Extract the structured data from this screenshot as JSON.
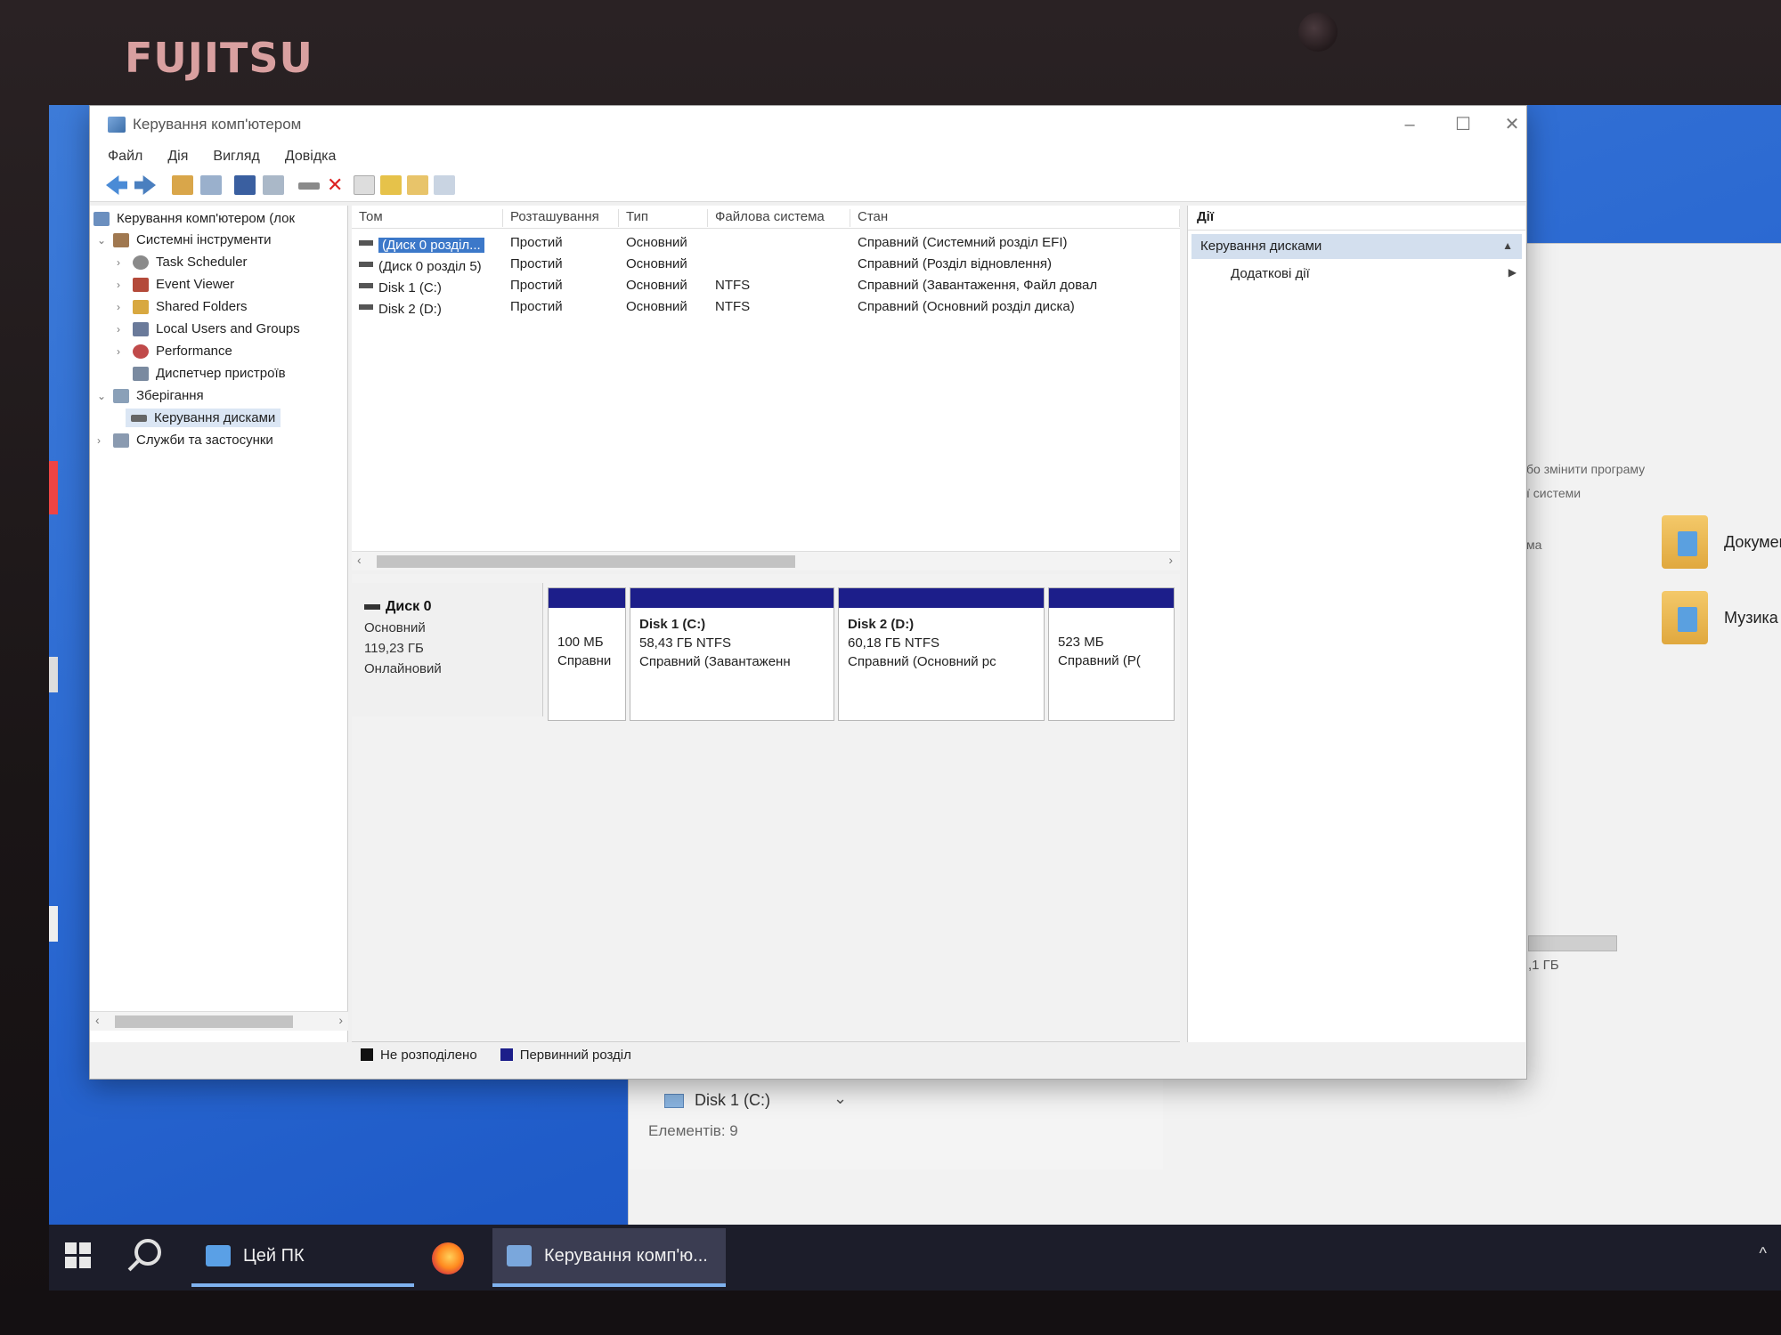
{
  "device": {
    "brand": "FUJITSU"
  },
  "window": {
    "title": "Керування комп'ютером",
    "menu": [
      "Файл",
      "Дія",
      "Вигляд",
      "Довідка"
    ]
  },
  "tree": {
    "root": "Керування комп'ютером (лок",
    "items": [
      {
        "label": "Системні інструменти"
      },
      {
        "label": "Task Scheduler"
      },
      {
        "label": "Event Viewer"
      },
      {
        "label": "Shared Folders"
      },
      {
        "label": "Local Users and Groups"
      },
      {
        "label": "Performance"
      },
      {
        "label": "Диспетчер пристроїв"
      },
      {
        "label": "Зберігання"
      },
      {
        "label": "Керування дисками"
      },
      {
        "label": "Служби та застосунки"
      }
    ]
  },
  "volumes": {
    "columns": [
      "Том",
      "Розташування",
      "Тип",
      "Файлова система",
      "Стан"
    ],
    "rows": [
      {
        "name": "(Диск 0 розділ...",
        "layout": "Простий",
        "type": "Основний",
        "fs": "",
        "status": "Справний (Системний розділ EFI)"
      },
      {
        "name": "(Диск 0 розділ 5)",
        "layout": "Простий",
        "type": "Основний",
        "fs": "",
        "status": "Справний (Розділ відновлення)"
      },
      {
        "name": "Disk 1 (C:)",
        "layout": "Простий",
        "type": "Основний",
        "fs": "NTFS",
        "status": "Справний (Завантаження, Файл довал"
      },
      {
        "name": "Disk 2 (D:)",
        "layout": "Простий",
        "type": "Основний",
        "fs": "NTFS",
        "status": "Справний (Основний розділ диска)"
      }
    ]
  },
  "disk0": {
    "name": "Диск 0",
    "kind": "Основний",
    "size": "119,23 ГБ",
    "state": "Онлайновий",
    "partitions": [
      {
        "title": "",
        "size": "100 МБ",
        "status": "Справни"
      },
      {
        "title": "Disk 1  (C:)",
        "size": "58,43 ГБ NTFS",
        "status": "Справний (Завантаженн"
      },
      {
        "title": "Disk 2  (D:)",
        "size": "60,18 ГБ NTFS",
        "status": "Справний (Основний рс"
      },
      {
        "title": "",
        "size": "523 МБ",
        "status": "Справний (Р("
      }
    ]
  },
  "legend": {
    "unallocated": "Не розподілено",
    "primary": "Первинний розділ",
    "unallocated_color": "#111111",
    "primary_color": "#1c1e8a"
  },
  "actions": {
    "header": "Дії",
    "section": "Керування дисками",
    "item": "Додаткові дії"
  },
  "explorer": {
    "hint1": "бо змінити програму",
    "hint2": "ї системи",
    "hint3": "ма",
    "folders": [
      "Документи",
      "Музика"
    ],
    "size_text": ",1 ГБ",
    "drive": "Disk 1 (C:)",
    "count": "Елементів: 9"
  },
  "taskbar": {
    "pc": "Цей ПК",
    "mmc": "Керування комп'ю..."
  }
}
